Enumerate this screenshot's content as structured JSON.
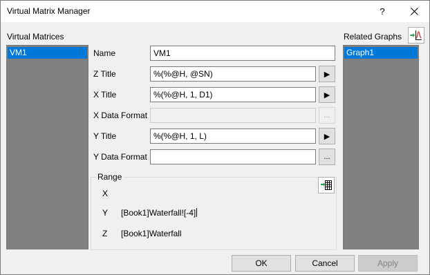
{
  "window": {
    "title": "Virtual Matrix Manager",
    "help_glyph": "?",
    "close_icon": "close-icon"
  },
  "left_panel": {
    "label": "Virtual Matrices",
    "items": [
      "VM1"
    ],
    "selected_index": 0
  },
  "form": {
    "name_label": "Name",
    "name_value": "VM1",
    "z_title_label": "Z Title",
    "z_title_value": "%(%@H, @SN)",
    "x_title_label": "X Title",
    "x_title_value": "%(%@H, 1, D1)",
    "x_data_format_label": "X Data Format",
    "x_data_format_value": "",
    "y_title_label": "Y Title",
    "y_title_value": "%(%@H, 1, L)",
    "y_data_format_label": "Y Data Format",
    "y_data_format_value": "",
    "arrow_glyph": "▶",
    "ellipsis_glyph": "..."
  },
  "range": {
    "label": "Range",
    "x_label": "X",
    "x_value": "",
    "y_label": "Y",
    "y_value": "[Book1]Waterfall![-4]",
    "z_label": "Z",
    "z_value": "[Book1]Waterfall",
    "select_icon": "worksheet-select-icon"
  },
  "right_panel": {
    "label": "Related Graphs",
    "items": [
      "Graph1"
    ],
    "selected_index": 0,
    "add_graph_icon": "add-graph-icon"
  },
  "buttons": {
    "ok": "OK",
    "cancel": "Cancel",
    "apply": "Apply"
  },
  "colors": {
    "selection": "#0078d7",
    "list_background": "#808080",
    "dialog_background": "#f0f0f0"
  }
}
